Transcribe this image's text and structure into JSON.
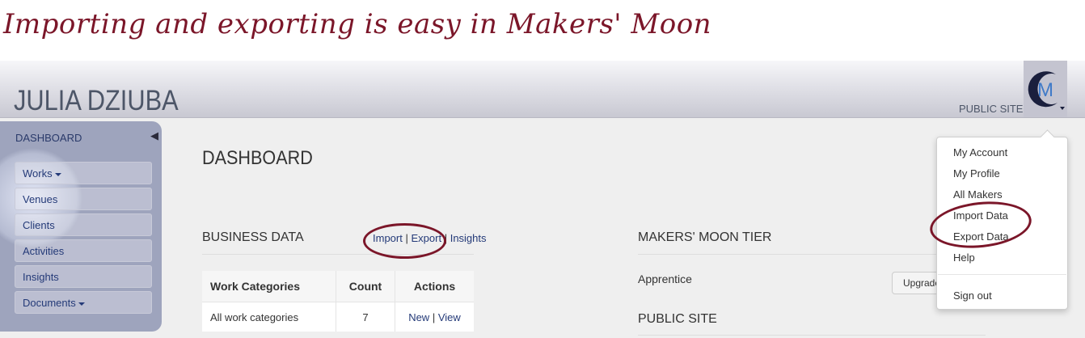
{
  "caption": "Importing and exporting is easy in Makers' Moon",
  "header": {
    "brand": "JULIA DZIUBA",
    "public_site": "PUBLIC SITE",
    "logo_icon": "makers-moon-crescent-logo"
  },
  "sidebar": {
    "title": "DASHBOARD",
    "items": [
      {
        "label": "Works",
        "dropdown": true
      },
      {
        "label": "Venues"
      },
      {
        "label": "Clients"
      },
      {
        "label": "Activities"
      },
      {
        "label": "Insights"
      },
      {
        "label": "Documents",
        "dropdown": true
      }
    ]
  },
  "main": {
    "title": "DASHBOARD",
    "business_data": {
      "heading": "BUSINESS DATA",
      "import": "Import",
      "export": "Export",
      "insights": "Insights",
      "table": {
        "headers": [
          "Work Categories",
          "Count",
          "Actions"
        ],
        "rows": [
          {
            "category": "All work categories",
            "count": "7",
            "new": "New",
            "view": "View"
          }
        ]
      }
    },
    "tier": {
      "heading": "MAKERS' MOON TIER",
      "level": "Apprentice",
      "upgrade": "Upgrade"
    },
    "public_site_heading": "PUBLIC SITE"
  },
  "dropdown_menu": {
    "items": [
      "My Account",
      "My Profile",
      "All Makers",
      "Import Data",
      "Export Data",
      "Help"
    ],
    "signout": "Sign out"
  },
  "colors": {
    "annotation": "#7b1629",
    "link": "#243a78"
  }
}
